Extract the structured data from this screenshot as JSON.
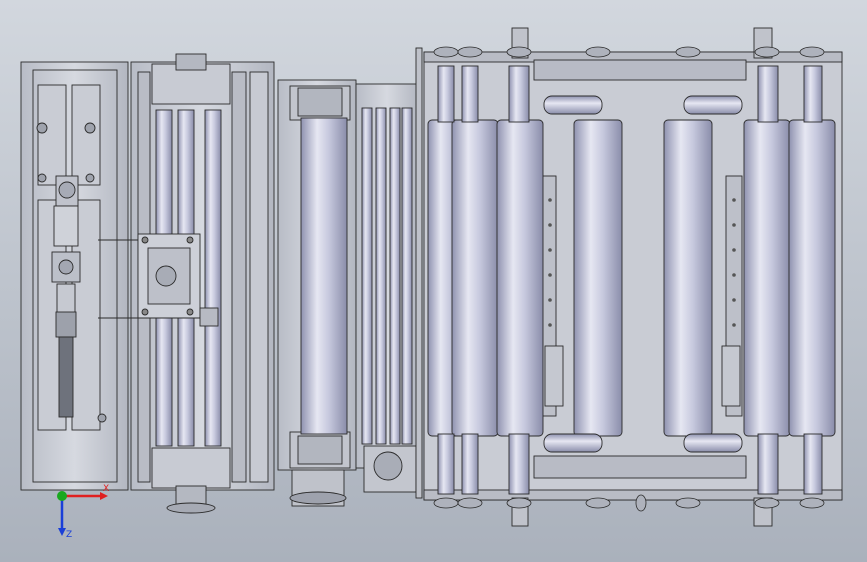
{
  "viewport": {
    "background_top": "#d2d7de",
    "background_bottom": "#aab1bc"
  },
  "colors": {
    "roller_light": "#e6e7f2",
    "roller_mid": "#b9bbd3",
    "roller_dark": "#8f92b0",
    "frame_fill": "#c4c7cf",
    "line": "#2b2b2b"
  },
  "triad": {
    "x_label": "X",
    "z_label": "Z",
    "x_color": "#e02020",
    "z_color": "#1a3fd8",
    "y_color": "#19a81f"
  }
}
